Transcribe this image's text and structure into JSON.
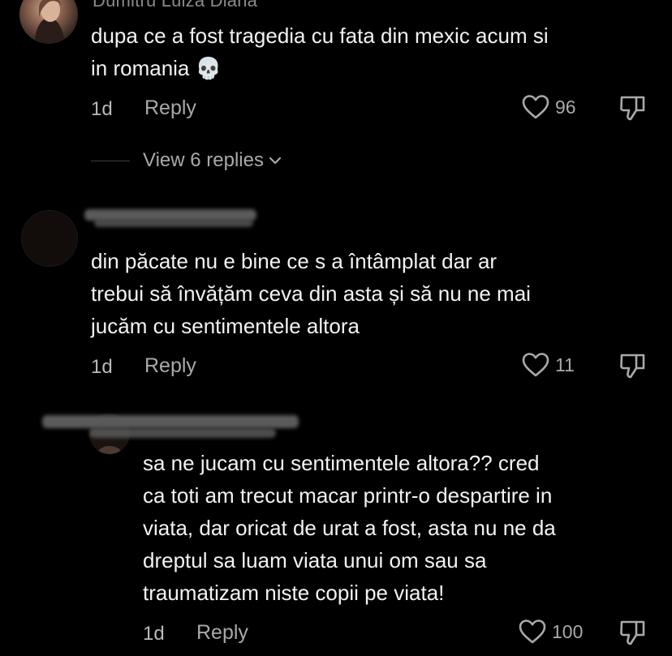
{
  "colors": {
    "background": "#000000",
    "text": "#f2f2f2",
    "muted": "#a9a9a9",
    "redaction": "#5a5a5a"
  },
  "comments": [
    {
      "username": "Dumitru Luiza Diana",
      "text_lines": [
        "dupa ce a fost tragedia cu fata din mexic acum si",
        "in romania 💀"
      ],
      "time": "1d",
      "reply_label": "Reply",
      "likes": "96",
      "view_replies_label": "View 6 replies",
      "like_icon": "heart-outline-icon",
      "dislike_icon": "thumbs-down-icon"
    },
    {
      "username": "",
      "text_lines": [
        "din păcate nu e bine ce s a întâmplat dar ar",
        "trebui să învățăm ceva din asta și să nu ne mai",
        "jucăm cu sentimentele altora"
      ],
      "time": "1d",
      "reply_label": "Reply",
      "likes": "11",
      "like_icon": "heart-outline-icon",
      "dislike_icon": "thumbs-down-icon"
    }
  ],
  "reply": {
    "username": "",
    "text_lines": [
      "sa ne jucam cu sentimentele altora?? cred",
      "ca toti am trecut macar printr-o despartire in",
      "viata, dar oricat de urat a fost, asta nu ne da",
      "dreptul sa luam viata unui om sau sa",
      "traumatizam niste copii pe viata!"
    ],
    "time": "1d",
    "reply_label": "Reply",
    "likes": "100",
    "like_icon": "heart-outline-icon",
    "dislike_icon": "thumbs-down-icon"
  }
}
